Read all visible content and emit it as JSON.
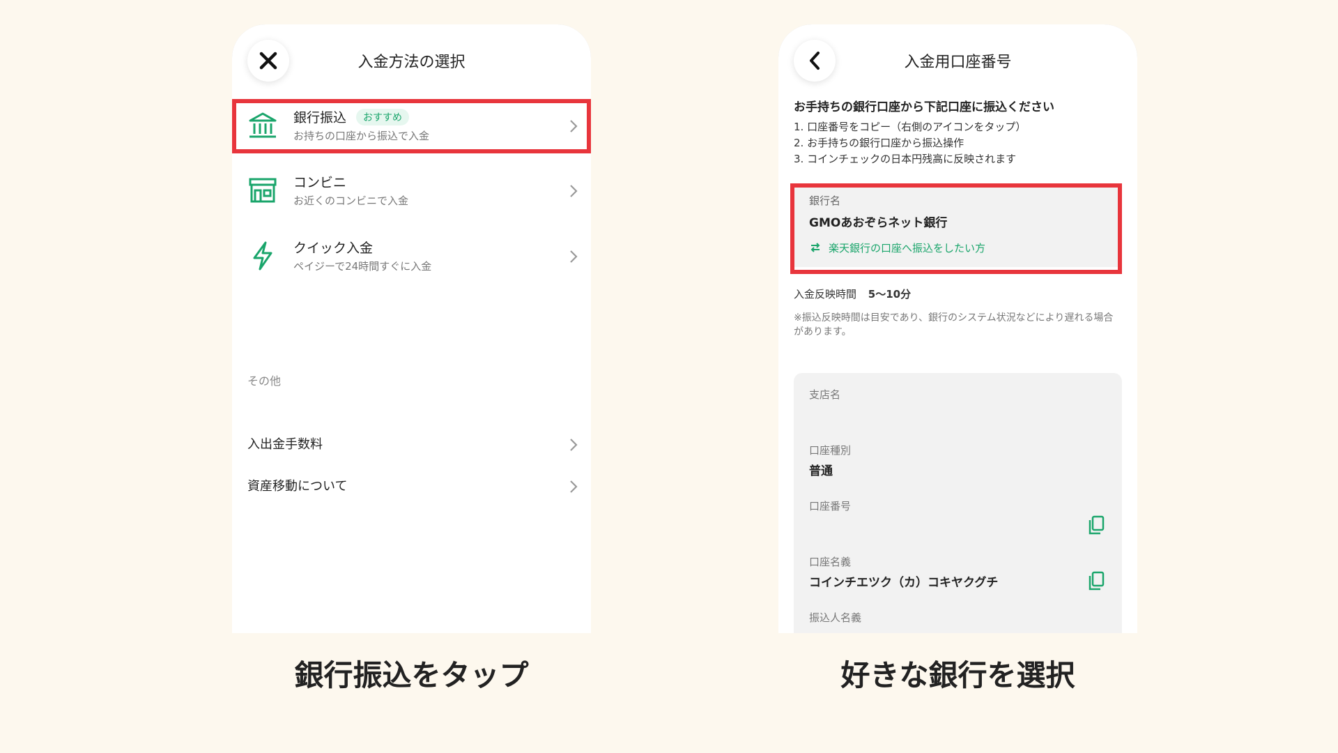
{
  "left": {
    "title": "入金方法の選択",
    "methods": [
      {
        "title": "銀行振込",
        "badge": "おすすめ",
        "subtitle": "お持ちの口座から振込で入金"
      },
      {
        "title": "コンビニ",
        "subtitle": "お近くのコンビニで入金"
      },
      {
        "title": "クイック入金",
        "subtitle": "ペイジーで24時間すぐに入金"
      }
    ],
    "other_label": "その他",
    "other_items": [
      {
        "title": "入出金手数料"
      },
      {
        "title": "資産移動について"
      }
    ],
    "caption": "銀行振込をタップ"
  },
  "right": {
    "title": "入金用口座番号",
    "instruction_title": "お手持ちの銀行口座から下記口座に振込ください",
    "steps": [
      "1. 口座番号をコピー（右側のアイコンをタップ）",
      "2. お手持ちの銀行口座から振込操作",
      "3. コインチェックの日本円残高に反映されます"
    ],
    "bank_label": "銀行名",
    "bank_name": "GMOあおぞらネット銀行",
    "switch_link": "楽天銀行の口座へ振込をしたい方",
    "reflect_label": "入金反映時間",
    "reflect_value": "5〜10分",
    "note": "※振込反映時間は目安であり、銀行のシステム状況などにより遅れる場合があります。",
    "fields": [
      {
        "label": "支店名",
        "value": ""
      },
      {
        "label": "口座種別",
        "value": "普通"
      },
      {
        "label": "口座番号",
        "value": ""
      },
      {
        "label": "口座名義",
        "value": "コインチエツク（カ）コキヤクグチ"
      },
      {
        "label": "振込人名義",
        "value": ""
      }
    ],
    "caption": "好きな銀行を選択"
  },
  "colors": {
    "accent": "#1aa56b",
    "highlight": "#e8353c",
    "background": "#fdf8ee"
  }
}
